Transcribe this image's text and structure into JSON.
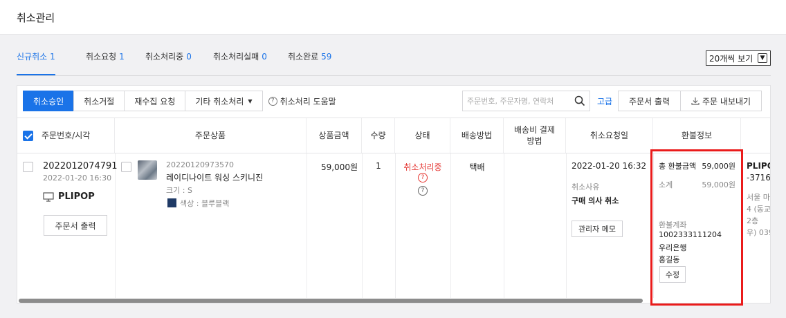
{
  "header": {
    "title": "취소관리"
  },
  "tabs": [
    {
      "label": "신규취소",
      "count": "1"
    },
    {
      "label": "취소요청",
      "count": "1"
    },
    {
      "label": "취소처리중",
      "count": "0"
    },
    {
      "label": "취소처리실패",
      "count": "0"
    },
    {
      "label": "취소완료",
      "count": "59"
    }
  ],
  "view_select": {
    "value": "20개씩 보기"
  },
  "toolbar": {
    "approve": "취소승인",
    "reject": "취소거절",
    "recollect": "재수집 요청",
    "other": "기타 취소처리",
    "help": "취소처리 도움말",
    "search_placeholder": "주문번호, 주문자명, 연락처",
    "advanced": "고급",
    "print_order": "주문서 출력",
    "export": "주문 내보내기"
  },
  "columns": [
    "주문번호/시각",
    "주문상품",
    "상품금액",
    "수량",
    "상태",
    "배송방법",
    "배송비 결제방법",
    "취소요청일",
    "환불정보"
  ],
  "row": {
    "order_no": "2022012074791",
    "order_time": "2022-01-20 16:30",
    "channel": "PLIPOP",
    "print_btn": "주문서 출력",
    "product_code": "20220120973570",
    "product_name": "레이디나이트 워싱 스키니진",
    "option_size": "크기 : S",
    "option_color": "색상 : 블루블랙",
    "option_color_hex": "#1f3a66",
    "price": "59,000원",
    "qty": "1",
    "status": "취소처리중",
    "shipping_method": "택배",
    "request_date": "2022-01-20 16:32",
    "reason_label": "취소사유",
    "reason": "구매 의사 취소",
    "admin_memo": "관리자 메모",
    "refund": {
      "total_label": "총 환불금액",
      "total": "59,000원",
      "subtotal_label": "소계",
      "subtotal": "59,000원",
      "account_label": "환불계좌",
      "account_no": "1002333111204",
      "bank": "우리은행",
      "holder": "홍길동",
      "edit": "수정"
    },
    "next_col": {
      "name": "PLIPO",
      "phone": "-3716",
      "addr1": "서울 마",
      "addr2": "4 (동교",
      "addr3": "2층",
      "addr4": "우) 039"
    }
  },
  "colors": {
    "accent": "#1a73e8",
    "status_red": "#e53935",
    "highlight_box": "#ea1b1b"
  }
}
